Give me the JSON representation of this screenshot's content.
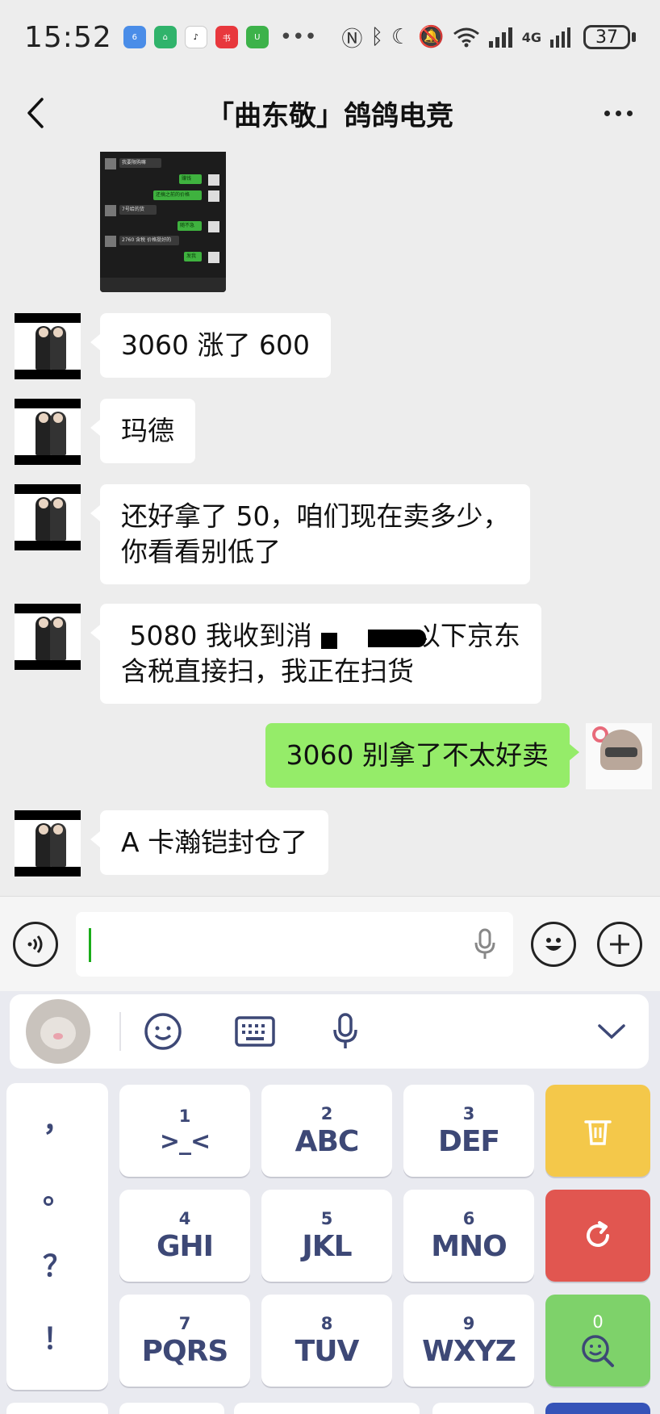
{
  "status_bar": {
    "time": "15:52",
    "network_label": "4G",
    "signal_sub": "6",
    "battery": "37"
  },
  "header": {
    "title": "「曲东敬」鸽鸽电竞"
  },
  "messages": [
    {
      "side": "in",
      "text": "3060 涨了 600"
    },
    {
      "side": "in",
      "text": "玛德"
    },
    {
      "side": "in",
      "text": "还好拿了 50，咱们现在卖多少，\n你看看别低了"
    },
    {
      "side": "in",
      "text": " 5080 我收到消            以下京东\n含税直接扫，我正在扫货"
    },
    {
      "side": "out",
      "text": "3060 别拿了不太好卖"
    },
    {
      "side": "in",
      "text": "A 卡瀚铠封仓了"
    }
  ],
  "shared_image_rows": [
    "我要限购嘛",
    "赚钱",
    "还搞之前的价格",
    "7号给的货",
    "随不急",
    "2760 含税 价格挺好的",
    "发我"
  ],
  "keyboard": {
    "keys": [
      {
        "num": "1",
        "letters": ">_<"
      },
      {
        "num": "2",
        "letters": "ABC"
      },
      {
        "num": "3",
        "letters": "DEF"
      },
      {
        "num": "4",
        "letters": "GHI"
      },
      {
        "num": "5",
        "letters": "JKL"
      },
      {
        "num": "6",
        "letters": "MNO"
      },
      {
        "num": "7",
        "letters": "PQRS"
      },
      {
        "num": "8",
        "letters": "TUV"
      },
      {
        "num": "9",
        "letters": "WXYZ"
      }
    ],
    "punctuation": [
      "，",
      "。",
      "？",
      "！"
    ],
    "search_key_count": "0"
  },
  "colors": {
    "outgoing_bubble": "#95ec69",
    "incoming_bubble": "#ffffff",
    "key_text": "#3d4876",
    "delete_key": "#f4c84a",
    "reset_key": "#e15650",
    "search_key": "#7ed26a"
  }
}
